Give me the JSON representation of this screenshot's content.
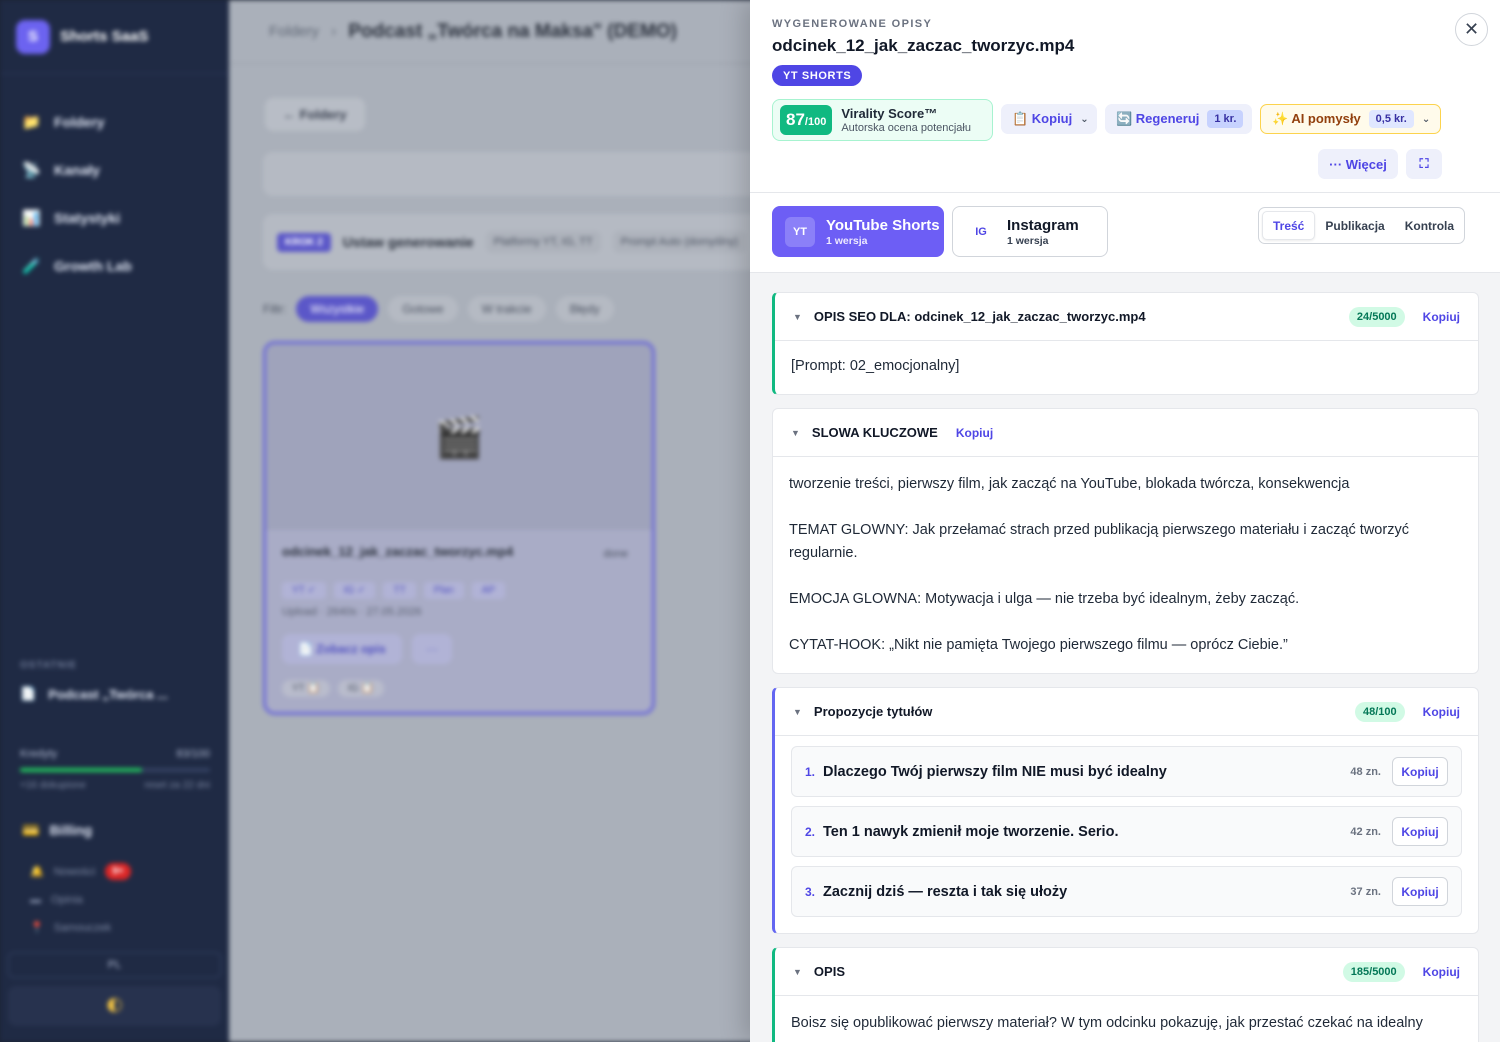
{
  "app": {
    "brand_letter": "S",
    "brand_name": "Shorts SaaS"
  },
  "sidebar": {
    "items": [
      {
        "icon": "folder-icon",
        "glyph": "📁",
        "label": "Foldery"
      },
      {
        "icon": "satellite-icon",
        "glyph": "📡",
        "label": "Kanały"
      },
      {
        "icon": "chart-icon",
        "glyph": "📊",
        "label": "Statystyki"
      },
      {
        "icon": "brush-icon",
        "glyph": "🧪",
        "label": "Growth Lab"
      }
    ],
    "recent_section": "OSTATNIE",
    "recent_item": "Podcast „Twórca ...",
    "credits_label": "Kredyty",
    "credits_value": "83/100",
    "credits_fill": 0.64,
    "credits_sub_left": "+16 dokupione",
    "credits_sub_right": "reset za 22 dni",
    "billing_label": "Billing",
    "small_items": [
      {
        "glyph": "🔔",
        "label": "Nowości",
        "badge": "9+"
      },
      {
        "glyph": "▬",
        "label": "Opinia",
        "badge": ""
      },
      {
        "glyph": "📍",
        "label": "Samouczek",
        "badge": ""
      }
    ],
    "lang": "PL",
    "theme_glyph": "🌓"
  },
  "background": {
    "breadcrumb": "Foldery",
    "title": "Podcast „Twórca na Maksa\" (DEMO)",
    "back_button": "← Foldery",
    "step_badge": "KROK 2",
    "step_title": "Ustaw generowanie",
    "chip_platforms": "Platformy  YT, IG, TT",
    "chip_prompt": "Prompt  Auto (domyślny)",
    "filter_label": "Filtr:",
    "filters": [
      "Wszystkie",
      "Gotowe",
      "W trakcie",
      "Błędy"
    ],
    "card": {
      "thumb_glyph": "🎬",
      "name": "odcinek_12_jak_zaczac_tworzyc.mp4",
      "status": "done",
      "tags": [
        "YT ✓",
        "IG ✓",
        "TT",
        "Plan",
        "AP"
      ],
      "upload": "Upload · 2640s · 27.05.2026",
      "see_button": "📄 Zobacz opis",
      "more_button": "···",
      "bottom": [
        "YT 📋",
        "IG 📋"
      ]
    }
  },
  "panel": {
    "eyebrow": "WYGENEROWANE OPISY",
    "filename": "odcinek_12_jak_zaczac_tworzyc.mp4",
    "platform_pill": "YT SHORTS",
    "close_glyph": "✕",
    "virality": {
      "score": "87",
      "max": "/100",
      "title": "Virality Score™",
      "subtitle": "Autorska ocena potencjału"
    },
    "copy_button": "📋 Kopiuj",
    "regen_button": "🔄 Regeneruj",
    "regen_cost": "1 kr.",
    "ai_button": "✨ AI pomysły",
    "ai_cost": "0,5 kr.",
    "more_button": "··· Więcej",
    "expand_glyph": "⛶",
    "platforms": [
      {
        "badge": "YT",
        "name": "YouTube Shorts",
        "versions": "1 wersja"
      },
      {
        "badge": "IG",
        "name": "Instagram",
        "versions": "1 wersja"
      }
    ],
    "tabs": [
      "Treść",
      "Publikacja",
      "Kontrola"
    ],
    "sections": {
      "seo": {
        "title": "OPIS SEO DLA: odcinek_12_jak_zaczac_tworzyc.mp4",
        "count": "24/5000",
        "copy": "Kopiuj",
        "text": "[Prompt: 02_emocjonalny]"
      },
      "keywords": {
        "title": "SLOWA KLUCZOWE",
        "copy": "Kopiuj",
        "lines": [
          "tworzenie treści, pierwszy film, jak zacząć na YouTube, blokada twórcza, konsekwencja",
          "TEMAT GLOWNY: Jak przełamać strach przed publikacją pierwszego materiału i zacząć tworzyć regularnie.",
          "EMOCJA GLOWNA: Motywacja i ulga — nie trzeba być idealnym, żeby zacząć.",
          "CYTAT-HOOK: „Nikt nie pamięta Twojego pierwszego filmu — oprócz Ciebie.”"
        ]
      },
      "titles": {
        "title": "Propozycje tytułów",
        "count": "48/100",
        "copy": "Kopiuj",
        "items": [
          {
            "num": "1.",
            "text": "Dlaczego Twój pierwszy film NIE musi być idealny",
            "len": "48 zn.",
            "copy": "Kopiuj"
          },
          {
            "num": "2.",
            "text": "Ten 1 nawyk zmienił moje tworzenie. Serio.",
            "len": "42 zn.",
            "copy": "Kopiuj"
          },
          {
            "num": "3.",
            "text": "Zacznij dziś — reszta i tak się ułoży",
            "len": "37 zn.",
            "copy": "Kopiuj"
          }
        ]
      },
      "desc": {
        "title": "OPIS",
        "count": "185/5000",
        "copy": "Kopiuj",
        "text": "Boisz się opublikować pierwszy materiał? W tym odcinku pokazuję, jak przestać czekać na idealny"
      }
    }
  }
}
